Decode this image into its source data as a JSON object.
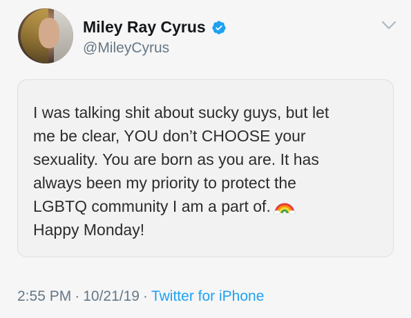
{
  "user": {
    "display_name": "Miley Ray Cyrus",
    "handle": "@MileyCyrus",
    "verified": true
  },
  "tweet": {
    "lines": [
      "I was talking shit about sucky guys, but let",
      "me be clear, YOU don’t CHOOSE your",
      "sexuality. You are born as you are. It has",
      "always been my priority to protect the",
      "LGBTQ community I am a part of.",
      "Happy Monday!"
    ]
  },
  "meta": {
    "time": "2:55 PM",
    "separator": "·",
    "date": "10/21/19",
    "source": "Twitter for iPhone"
  },
  "icons": {
    "verified": "verified-badge-icon",
    "menu": "chevron-down-icon",
    "emoji": "rainbow-emoji"
  },
  "colors": {
    "verified_badge": "#1da1f2",
    "link": "#1da1f2",
    "secondary_text": "#657786"
  }
}
